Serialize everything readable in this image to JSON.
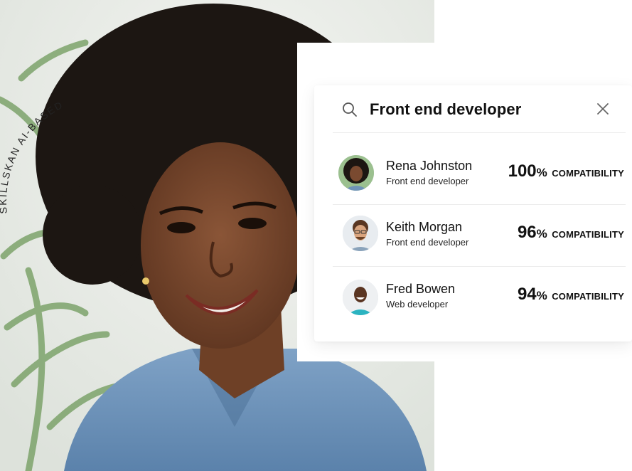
{
  "badge": {
    "text": "SKILLSKAN AI-BASED · SKILL"
  },
  "search": {
    "query": "Front end developer"
  },
  "results": [
    {
      "name": "Rena Johnston",
      "role": "Front end developer",
      "percent": "100",
      "percent_sign": "%",
      "label": "COMPATIBILITY"
    },
    {
      "name": "Keith Morgan",
      "role": "Front end developer",
      "percent": "96",
      "percent_sign": "%",
      "label": "COMPATIBILITY"
    },
    {
      "name": "Fred Bowen",
      "role": "Web developer",
      "percent": "94",
      "percent_sign": "%",
      "label": "COMPATIBILITY"
    }
  ],
  "icons": {
    "search": "search-icon",
    "close": "close-icon"
  },
  "colors": {
    "text": "#111111",
    "divider": "#ececec",
    "shirt": "#6f93b8",
    "skin": "#7a4a30",
    "hair": "#1c1612"
  }
}
